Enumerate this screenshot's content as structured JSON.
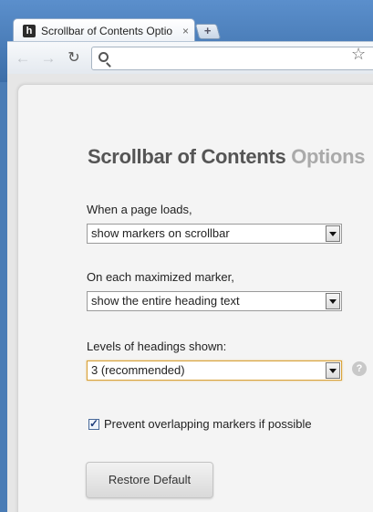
{
  "browser": {
    "tab_title": "Scrollbar of Contents Optio",
    "tab_close": "×",
    "new_tab": "+",
    "favicon_letter": "h"
  },
  "toolbar": {
    "back_icon": "←",
    "forward_icon": "→",
    "reload_icon": "↻",
    "star_icon": "☆",
    "omnibox_value": ""
  },
  "page": {
    "title_main": "Scrollbar of Contents",
    "title_secondary": "Options",
    "page_load": {
      "label": "When a page loads,",
      "selected": "show markers on scrollbar"
    },
    "maximized_marker": {
      "label": "On each maximized marker,",
      "selected": "show the entire heading text"
    },
    "heading_levels": {
      "label": "Levels of headings shown:",
      "selected": "3 (recommended)",
      "help": "?"
    },
    "overlap": {
      "label": "Prevent overlapping markers if possible",
      "checked": true
    },
    "restore_label": "Restore Default"
  },
  "colors": {
    "frame": "#4a7cb5",
    "focus_border": "#d8a23a",
    "title_secondary": "#aaaaaa"
  }
}
